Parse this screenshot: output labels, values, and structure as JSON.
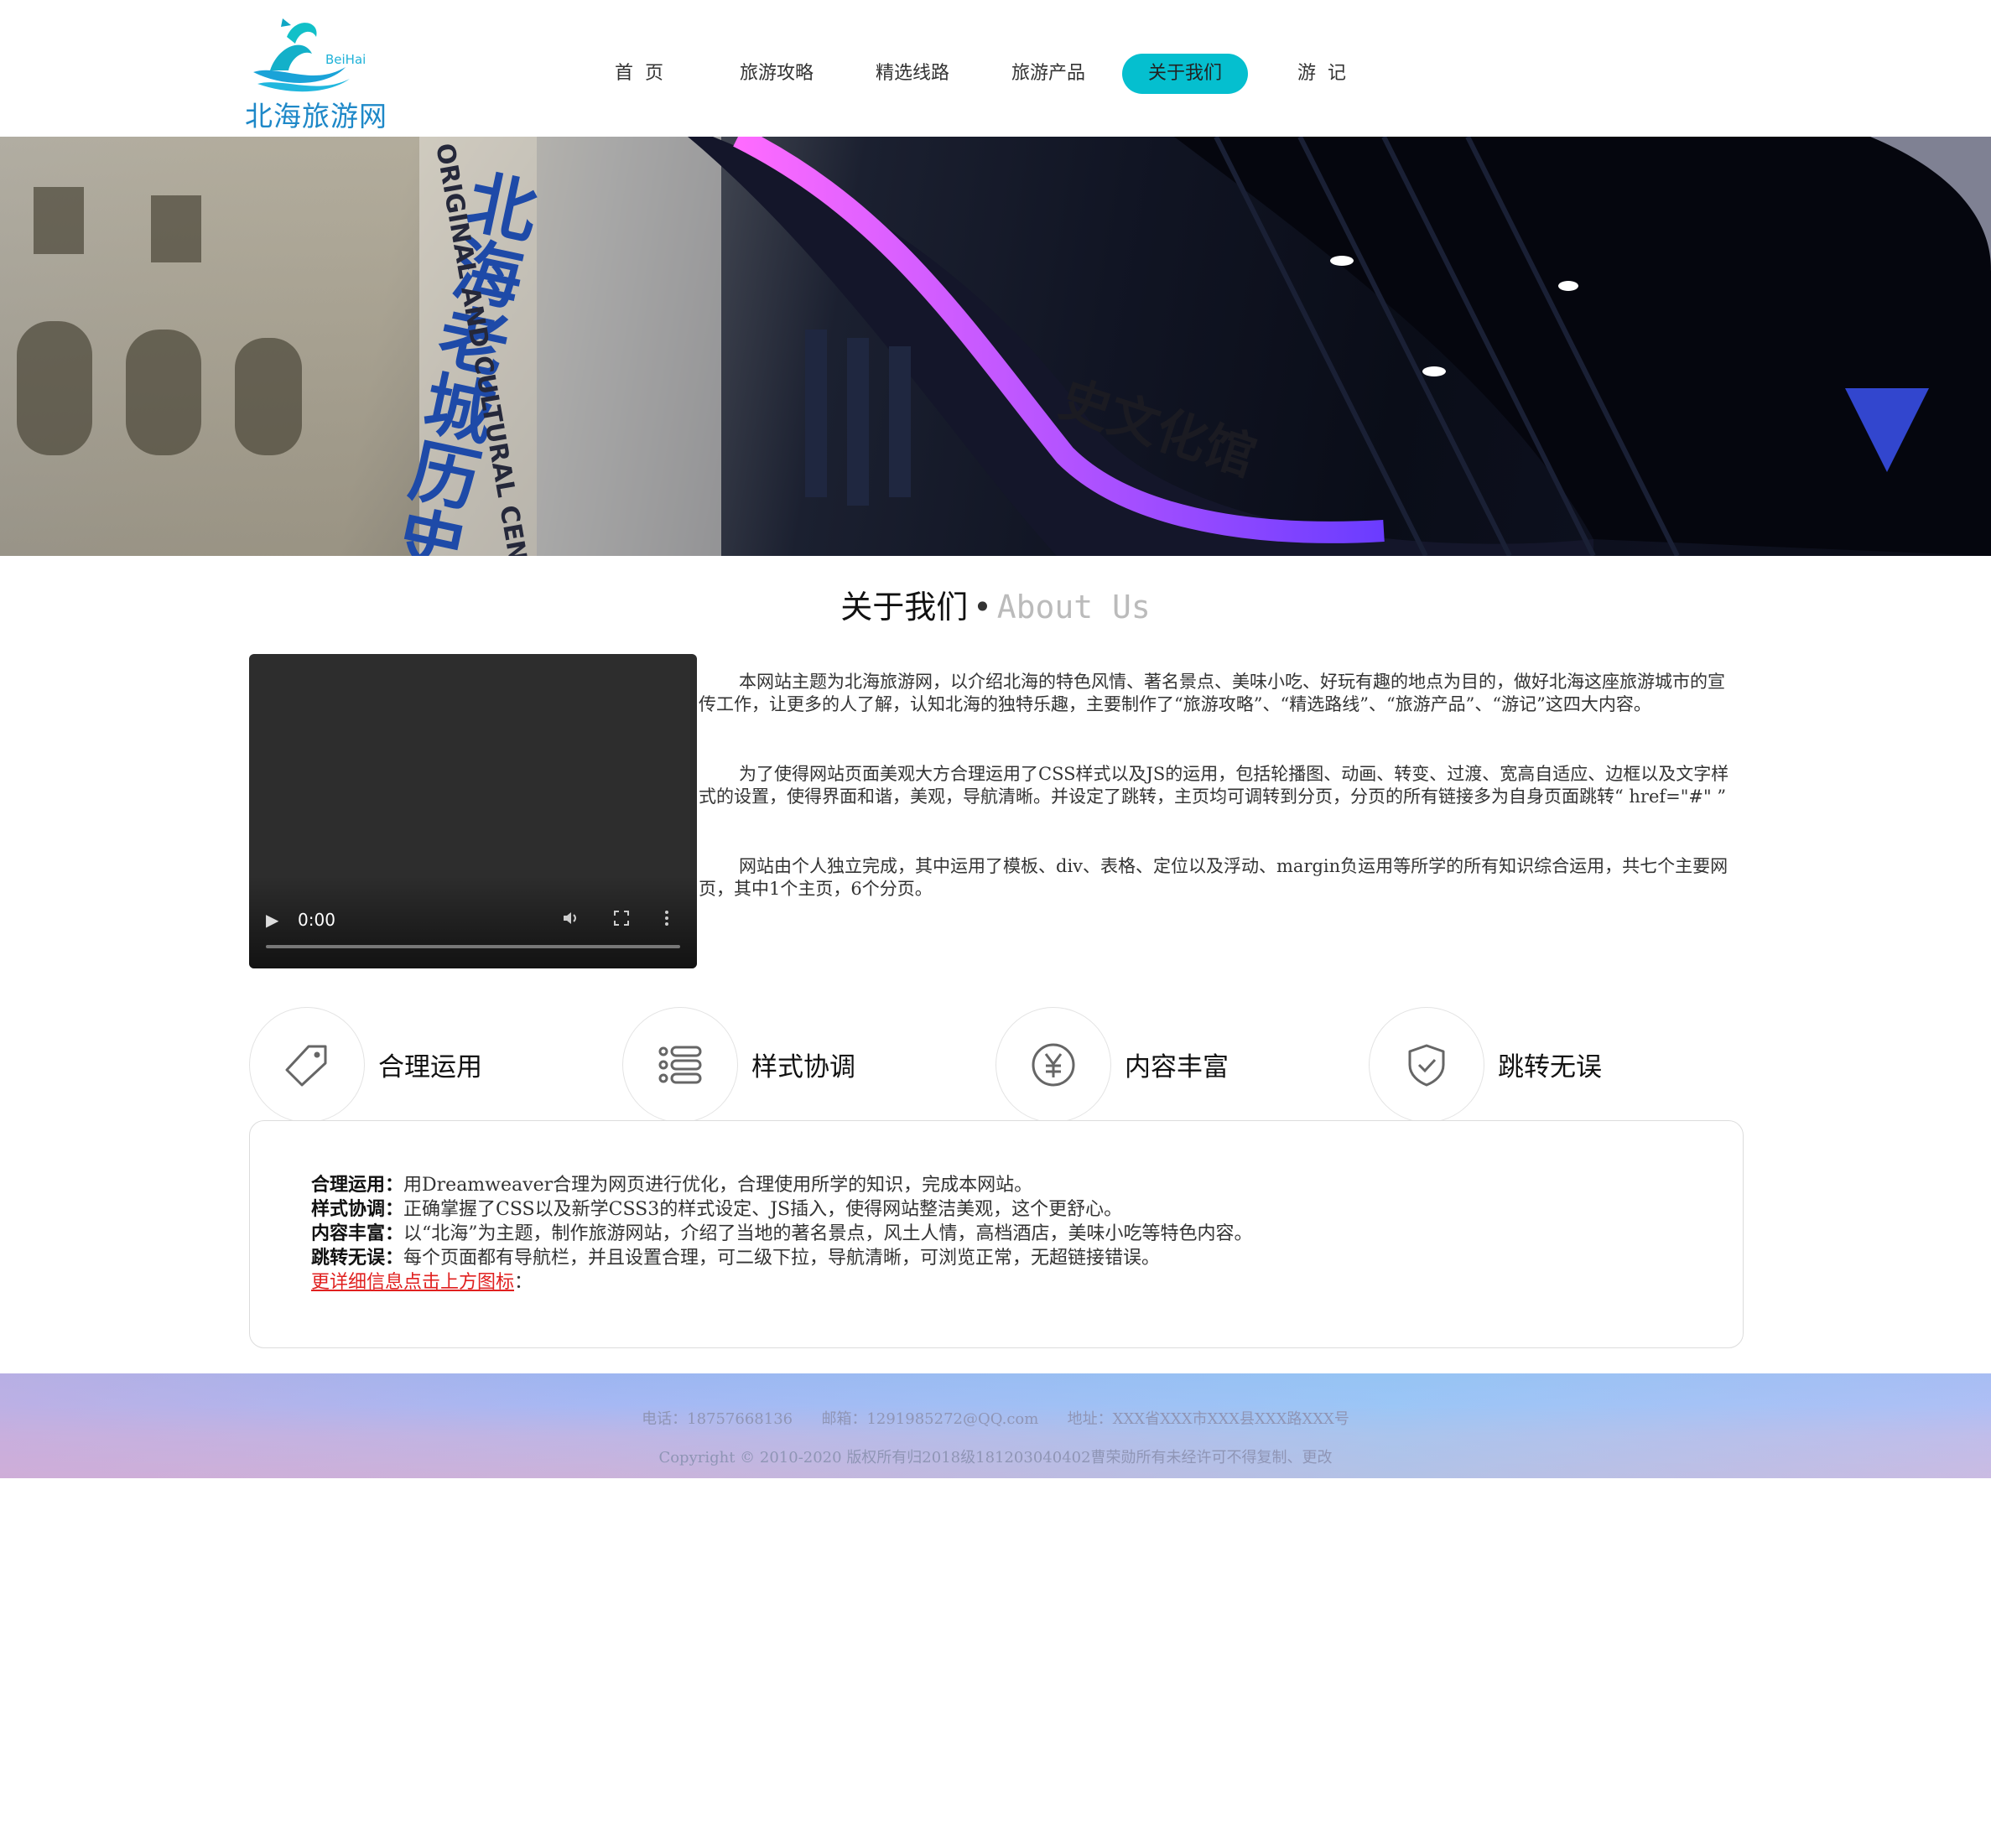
{
  "header": {
    "logo_text": "北海旅游网",
    "logo_en": "BeiHai",
    "nav": [
      {
        "label": "首  页",
        "active": false
      },
      {
        "label": "旅游攻略",
        "active": false
      },
      {
        "label": "精选线路",
        "active": false
      },
      {
        "label": "旅游产品",
        "active": false
      },
      {
        "label": "关于我们",
        "active": true
      },
      {
        "label": "游  记",
        "active": false
      }
    ]
  },
  "banner": {
    "sign_cn_vertical": "北海老城历史",
    "sign_en_vertical": "ORIGINAL AND CULTURAL CENTER",
    "sign_cn_curve": "史文化馆"
  },
  "section": {
    "title_cn": "关于我们",
    "dot": "•",
    "title_en": "About Us"
  },
  "video": {
    "time": "0:00"
  },
  "about": {
    "paragraphs": [
      "本网站主题为北海旅游网，以介绍北海的特色风情、著名景点、美味小吃、好玩有趣的地点为目的，做好北海这座旅游城市的宣传工作，让更多的人了解，认知北海的独特乐趣，主要制作了“旅游攻略”、“精选路线”、“旅游产品”、“游记”这四大内容。",
      "为了使得网站页面美观大方合理运用了CSS样式以及JS的运用，包括轮播图、动画、转变、过渡、宽高自适应、边框以及文字样式的设置，使得界面和谐，美观，导航清晰。并设定了跳转，主页均可调转到分页，分页的所有链接多为自身页面跳转“ href=\"#\" ”",
      "网站由个人独立完成，其中运用了模板、div、表格、定位以及浮动、margin负运用等所学的所有知识综合运用，共七个主要网页，其中1个主页，6个分页。"
    ]
  },
  "features": [
    {
      "label": "合理运用",
      "icon": "tag-icon"
    },
    {
      "label": "样式协调",
      "icon": "list-icon"
    },
    {
      "label": "内容丰富",
      "icon": "yen-icon"
    },
    {
      "label": "跳转无误",
      "icon": "shield-check-icon"
    }
  ],
  "info": {
    "lines": [
      {
        "key": "合理运用：",
        "text": "用Dreamweaver合理为网页进行优化，合理使用所学的知识，完成本网站。"
      },
      {
        "key": "样式协调：",
        "text": "正确掌握了CSS以及新学CSS3的样式设定、JS插入，使得网站整洁美观，这个更舒心。"
      },
      {
        "key": "内容丰富：",
        "text": "以“北海”为主题，制作旅游网站，介绍了当地的著名景点，风土人情，高档酒店，美味小吃等特色内容。"
      },
      {
        "key": "跳转无误：",
        "text": "每个页面都有导航栏，并且设置合理，可二级下拉，导航清晰，可浏览正常，无超链接错误。"
      }
    ],
    "more_link": "更详细信息点击上方图标",
    "more_suffix": "："
  },
  "footer": {
    "phone": "电话：18757668136",
    "email": "邮箱：1291985272@QQ.com",
    "address": "地址：XXX省XXX市XXX县XXX路XXX号",
    "copyright": "Copyright © 2010-2020 版权所有归2018级181203040402曹荣勋所有未经许可不得复制、更改"
  },
  "colors": {
    "accent": "#05bfcf",
    "link_red": "#e0201f",
    "logo_blue": "#1e88c8"
  }
}
